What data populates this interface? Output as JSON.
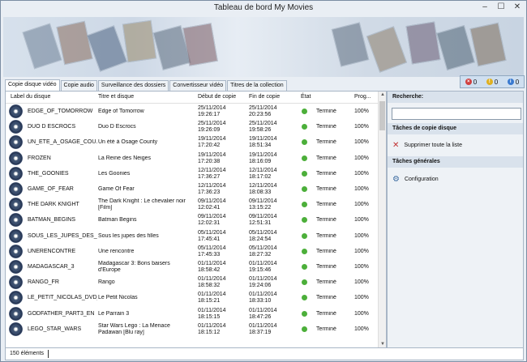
{
  "window": {
    "title": "Tableau de bord My Movies"
  },
  "notifications": {
    "errors": "0",
    "warnings": "0",
    "info": "0"
  },
  "tabs": [
    "Copie disque vidéo",
    "Copie audio",
    "Surveillance des dossiers",
    "Convertisseur vidéo",
    "Titres de la collection"
  ],
  "table": {
    "columns": [
      "Label du disque",
      "Titre et disque",
      "Début de copie",
      "Fin de copie",
      "État",
      "Prog..."
    ],
    "rows": [
      {
        "label": "EDGE_OF_TOMORROW",
        "title": [
          "Edge of Tomorrow",
          ""
        ],
        "start": [
          "25/11/2014",
          "19:26:17"
        ],
        "end": [
          "25/11/2014",
          "20:23:56"
        ],
        "state": "Terminé",
        "progress": "100%"
      },
      {
        "label": "DUO D ESCROCS",
        "title": [
          "Duo D Escrocs",
          ""
        ],
        "start": [
          "25/11/2014",
          "19:26:09"
        ],
        "end": [
          "25/11/2014",
          "19:58:26"
        ],
        "state": "Terminé",
        "progress": "100%"
      },
      {
        "label": "UN_ETE_A_OSAGE_COU...",
        "title": [
          "Un été à Osage County",
          ""
        ],
        "start": [
          "19/11/2014",
          "17:20:42"
        ],
        "end": [
          "19/11/2014",
          "18:51:34"
        ],
        "state": "Terminé",
        "progress": "100%"
      },
      {
        "label": "FROZEN",
        "title": [
          "La Reine des Neiges",
          ""
        ],
        "start": [
          "19/11/2014",
          "17:20:38"
        ],
        "end": [
          "19/11/2014",
          "18:16:09"
        ],
        "state": "Terminé",
        "progress": "100%"
      },
      {
        "label": "THE_GOONIES",
        "title": [
          "Les Goonies",
          ""
        ],
        "start": [
          "12/11/2014",
          "17:36:27"
        ],
        "end": [
          "12/11/2014",
          "18:17:02"
        ],
        "state": "Terminé",
        "progress": "100%"
      },
      {
        "label": "GAME_OF_FEAR",
        "title": [
          "Game Of Fear",
          ""
        ],
        "start": [
          "12/11/2014",
          "17:36:23"
        ],
        "end": [
          "12/11/2014",
          "18:08:33"
        ],
        "state": "Terminé",
        "progress": "100%"
      },
      {
        "label": "THE DARK KNIGHT",
        "title": [
          "The Dark Knight : Le chevalier noir",
          "[Film]"
        ],
        "start": [
          "09/11/2014",
          "12:02:41"
        ],
        "end": [
          "09/11/2014",
          "13:15:22"
        ],
        "state": "Terminé",
        "progress": "100%"
      },
      {
        "label": "BATMAN_BEGINS",
        "title": [
          "Batman Begins",
          ""
        ],
        "start": [
          "09/11/2014",
          "12:02:31"
        ],
        "end": [
          "09/11/2014",
          "12:51:31"
        ],
        "state": "Terminé",
        "progress": "100%"
      },
      {
        "label": "SOUS_LES_JUPES_DES_FI...",
        "title": [
          "Sous les jupes des filles",
          ""
        ],
        "start": [
          "05/11/2014",
          "17:45:41"
        ],
        "end": [
          "05/11/2014",
          "18:24:54"
        ],
        "state": "Terminé",
        "progress": "100%"
      },
      {
        "label": "UNERENCONTRE",
        "title": [
          "Une rencontre",
          ""
        ],
        "start": [
          "05/11/2014",
          "17:45:33"
        ],
        "end": [
          "05/11/2014",
          "18:27:32"
        ],
        "state": "Terminé",
        "progress": "100%"
      },
      {
        "label": "MADAGASCAR_3",
        "title": [
          "Madagascar 3: Bons baisers",
          "d'Europe"
        ],
        "start": [
          "01/11/2014",
          "18:58:42"
        ],
        "end": [
          "01/11/2014",
          "19:15:46"
        ],
        "state": "Terminé",
        "progress": "100%"
      },
      {
        "label": "RANGO_FR",
        "title": [
          "Rango",
          ""
        ],
        "start": [
          "01/11/2014",
          "18:58:32"
        ],
        "end": [
          "01/11/2014",
          "19:24:06"
        ],
        "state": "Terminé",
        "progress": "100%"
      },
      {
        "label": "LE_PETIT_NICOLAS_DVD_1",
        "title": [
          "Le Petit Nicolas",
          ""
        ],
        "start": [
          "01/11/2014",
          "18:15:21"
        ],
        "end": [
          "01/11/2014",
          "18:33:10"
        ],
        "state": "Terminé",
        "progress": "100%"
      },
      {
        "label": "GODFATHER_PART3_EN",
        "title": [
          "Le Parrain 3",
          ""
        ],
        "start": [
          "01/11/2014",
          "18:15:15"
        ],
        "end": [
          "01/11/2014",
          "18:47:26"
        ],
        "state": "Terminé",
        "progress": "100%"
      },
      {
        "label": "LEGO_STAR_WARS",
        "title": [
          "Star Wars Lego : La Menace",
          "Padawan [Blu ray]"
        ],
        "start": [
          "01/11/2014",
          "18:15:12"
        ],
        "end": [
          "01/11/2014",
          "18:37:19"
        ],
        "state": "Terminé",
        "progress": "100%"
      }
    ]
  },
  "status": {
    "count": "150 éléments"
  },
  "sidebar": {
    "search_title": "Recherche:",
    "search_value": "",
    "copy_tasks_title": "Tâches de copie disque",
    "delete_all": "Supprimer toute la liste",
    "general_tasks_title": "Tâches générales",
    "configuration": "Configuration"
  }
}
